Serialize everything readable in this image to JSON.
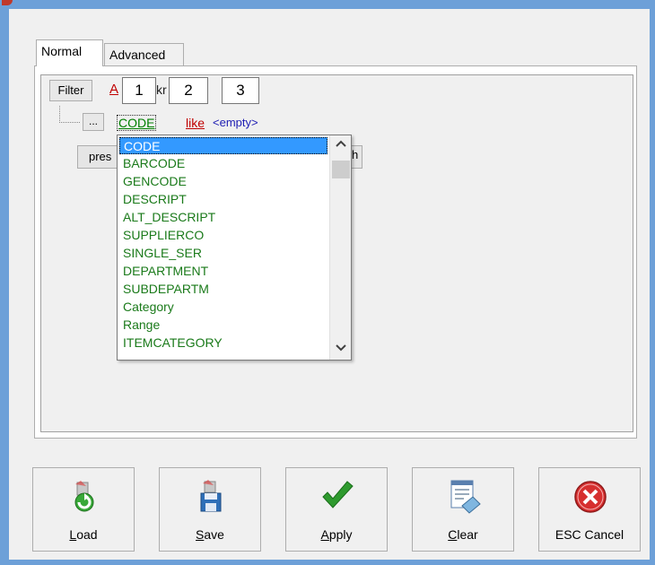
{
  "tabs": {
    "normal": "Normal",
    "advanced": "Advanced"
  },
  "filter": {
    "button": "Filter",
    "conjunction_partial": "A",
    "partial_text": "kr",
    "more_button": "...",
    "field": "CODE",
    "operator": "like",
    "value": "<empty>",
    "press_partial": "pres",
    "press_right": "h"
  },
  "markers": [
    "1",
    "2",
    "3"
  ],
  "dropdown": {
    "items": [
      "CODE",
      "BARCODE",
      "GENCODE",
      "DESCRIPT",
      "ALT_DESCRIPT",
      "SUPPLIERCO",
      "SINGLE_SER",
      "DEPARTMENT",
      "SUBDEPARTM",
      "Category",
      "Range",
      "ITEMCATEGORY"
    ],
    "selected": "CODE"
  },
  "buttons": {
    "load": {
      "first": "L",
      "rest": "oad"
    },
    "save": {
      "first": "S",
      "rest": "ave"
    },
    "apply": {
      "first": "A",
      "rest": "pply"
    },
    "clear": {
      "first": "C",
      "rest": "lear"
    },
    "cancel": "ESC Cancel"
  },
  "colors": {
    "field_green": "#008000",
    "operator_red": "#c00000",
    "selection_blue": "#3399ff",
    "value_blue": "#1e1eb4"
  }
}
